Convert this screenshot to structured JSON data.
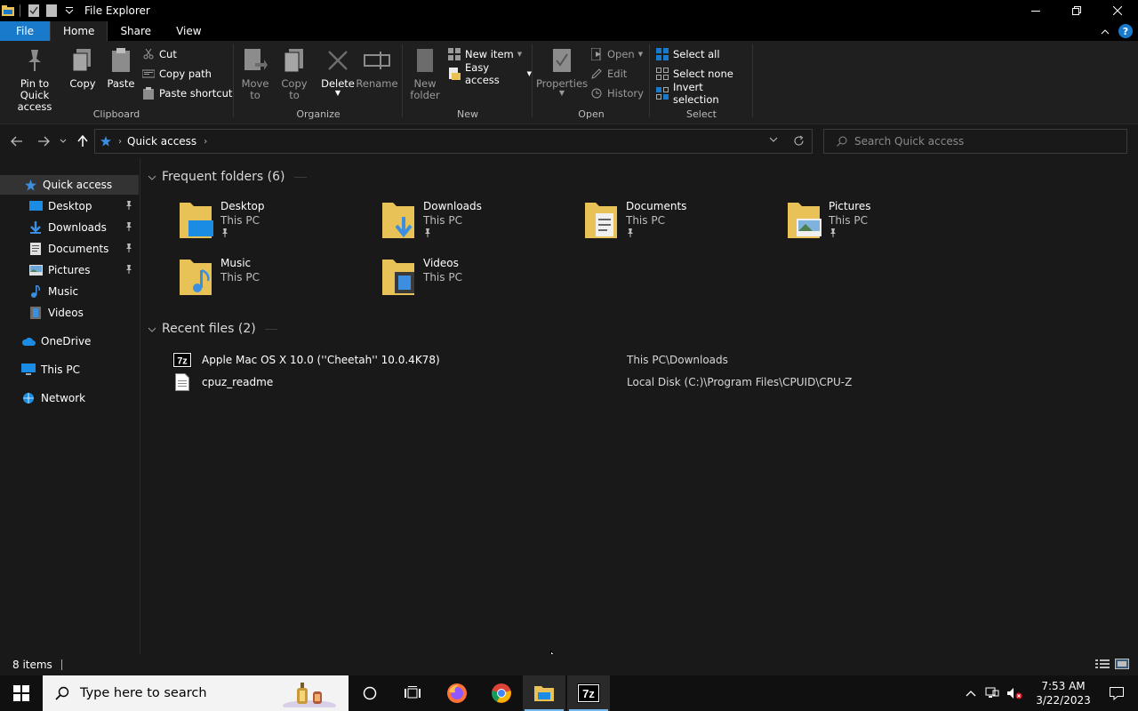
{
  "window": {
    "title": "File Explorer"
  },
  "ribbon_tabs": [
    "File",
    "Home",
    "Share",
    "View"
  ],
  "ribbon": {
    "clipboard": {
      "label": "Clipboard",
      "pin": "Pin to Quick\naccess",
      "copy": "Copy",
      "paste": "Paste",
      "cut": "Cut",
      "copy_path": "Copy path",
      "paste_shortcut": "Paste shortcut"
    },
    "organize": {
      "label": "Organize",
      "move_to": "Move\nto",
      "copy_to": "Copy\nto",
      "delete": "Delete",
      "rename": "Rename"
    },
    "new": {
      "label": "New",
      "new_folder": "New\nfolder",
      "new_item": "New item",
      "easy_access": "Easy access"
    },
    "open": {
      "label": "Open",
      "properties": "Properties",
      "open": "Open",
      "edit": "Edit",
      "history": "History"
    },
    "select": {
      "label": "Select",
      "select_all": "Select all",
      "select_none": "Select none",
      "invert": "Invert selection"
    }
  },
  "address": {
    "crumb": "Quick access"
  },
  "search": {
    "placeholder": "Search Quick access"
  },
  "sidebar": {
    "quick_access": "Quick access",
    "items": [
      {
        "label": "Desktop",
        "pinned": true
      },
      {
        "label": "Downloads",
        "pinned": true
      },
      {
        "label": "Documents",
        "pinned": true
      },
      {
        "label": "Pictures",
        "pinned": true
      },
      {
        "label": "Music",
        "pinned": false
      },
      {
        "label": "Videos",
        "pinned": false
      }
    ],
    "onedrive": "OneDrive",
    "this_pc": "This PC",
    "network": "Network"
  },
  "frequent": {
    "header": "Frequent folders (6)",
    "folders": [
      {
        "name": "Desktop",
        "location": "This PC"
      },
      {
        "name": "Downloads",
        "location": "This PC"
      },
      {
        "name": "Documents",
        "location": "This PC"
      },
      {
        "name": "Pictures",
        "location": "This PC"
      },
      {
        "name": "Music",
        "location": "This PC"
      },
      {
        "name": "Videos",
        "location": "This PC"
      }
    ]
  },
  "recent": {
    "header": "Recent files (2)",
    "files": [
      {
        "name": "Apple Mac OS X 10.0 (''Cheetah'' 10.0.4K78)",
        "path": "This PC\\Downloads",
        "icon": "7z-archive-icon"
      },
      {
        "name": "cpuz_readme",
        "path": "Local Disk (C:)\\Program Files\\CPUID\\CPU-Z",
        "icon": "text-file-icon"
      }
    ]
  },
  "status": {
    "count": "8 items"
  },
  "taskbar": {
    "search_placeholder": "Type here to search",
    "time": "7:53 AM",
    "date": "3/22/2023"
  },
  "colors": {
    "accent": "#1979ca",
    "folder": "#e8c257",
    "background": "#191919"
  }
}
